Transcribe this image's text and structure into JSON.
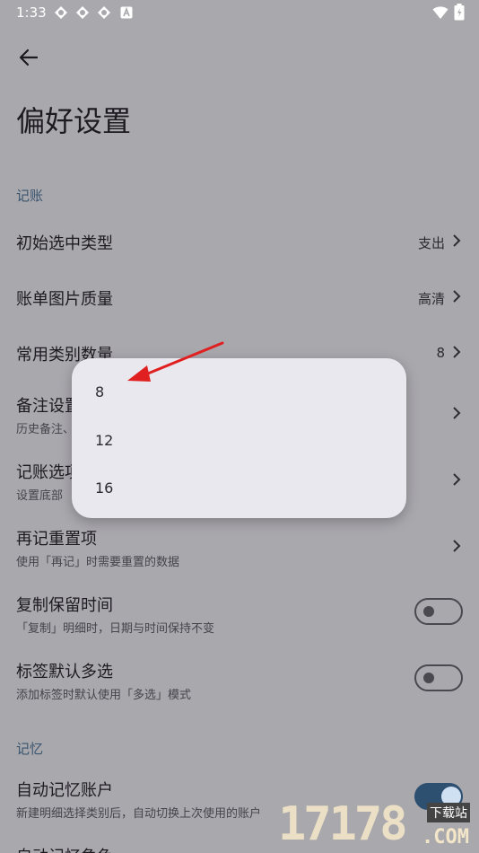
{
  "status": {
    "time": "1:33"
  },
  "page": {
    "title": "偏好设置"
  },
  "sections": {
    "bookkeeping": "记账",
    "memory": "记忆"
  },
  "rows": {
    "initial_type": {
      "title": "初始选中类型",
      "value": "支出"
    },
    "image_quality": {
      "title": "账单图片质量",
      "value": "高清"
    },
    "category_count": {
      "title": "常用类别数量",
      "value": "8"
    },
    "notes": {
      "title": "备注设置",
      "subtitle": "历史备注、"
    },
    "bookkeeping_options": {
      "title": "记账选项",
      "subtitle": "设置底部"
    },
    "reset_items": {
      "title": "再记重置项",
      "subtitle": "使用「再记」时需要重置的数据"
    },
    "copy_keep_time": {
      "title": "复制保留时间",
      "subtitle": "「复制」明细时，日期与时间保持不变",
      "on": false
    },
    "tag_multi": {
      "title": "标签默认多选",
      "subtitle": "添加标签时默认使用「多选」模式",
      "on": false
    },
    "auto_account": {
      "title": "自动记忆账户",
      "subtitle": "新建明细选择类别后，自动切换上次使用的账户",
      "on": true
    },
    "auto_role": {
      "title": "自动记忆角色"
    }
  },
  "dialog": {
    "options": [
      "8",
      "12",
      "16"
    ],
    "selected": "8"
  },
  "watermark": {
    "number": "17178",
    "label": "下载站",
    "domain": ".COM"
  },
  "colors": {
    "scrim_bg": "#a9a8ad",
    "accent": "#2d4f70",
    "arrow": "#e02020"
  }
}
